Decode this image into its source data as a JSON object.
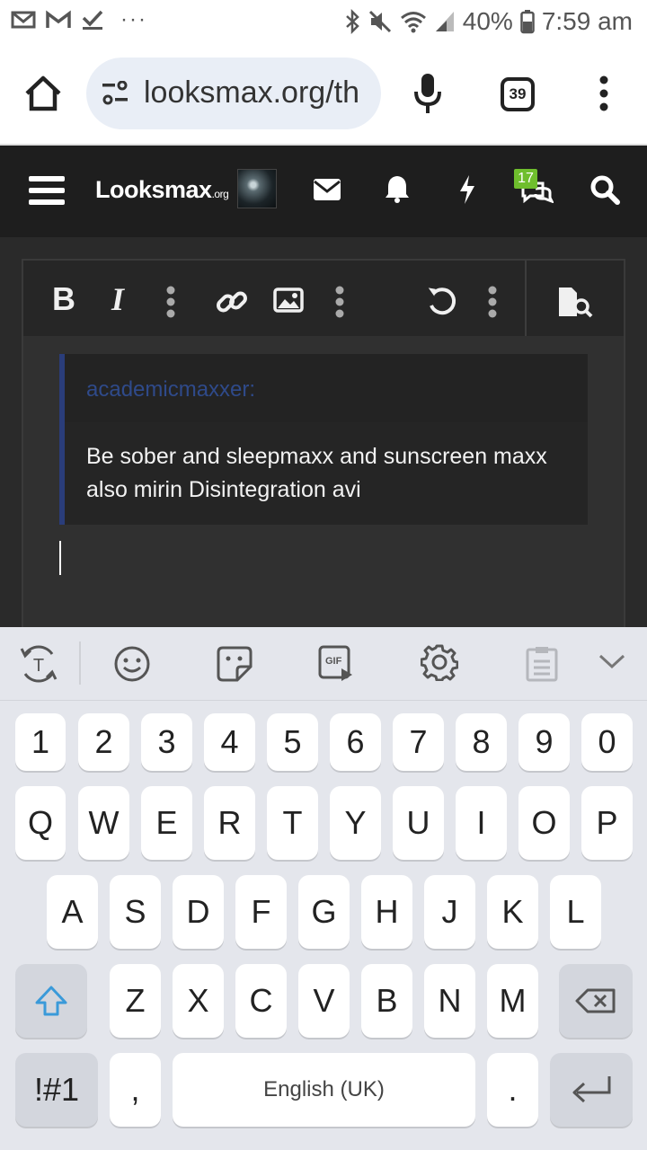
{
  "status_bar": {
    "battery": "40%",
    "time": "7:59 am",
    "overflow": "···"
  },
  "browser": {
    "url": "looksmax.org/th",
    "tab_count": "39"
  },
  "site": {
    "logo": "Looksmax",
    "logo_suffix": ".org",
    "conversations_badge": "17"
  },
  "editor": {
    "toolbar": {
      "bold": "B",
      "italic": "I"
    },
    "quote": {
      "author": "academicmaxxer:",
      "text": "Be sober and sleepmaxx and sunscreen maxx also mirin Disintegration avi"
    }
  },
  "keyboard": {
    "toolbar_gif": "GIF",
    "number_row": [
      "1",
      "2",
      "3",
      "4",
      "5",
      "6",
      "7",
      "8",
      "9",
      "0"
    ],
    "row1": [
      "Q",
      "W",
      "E",
      "R",
      "T",
      "Y",
      "U",
      "I",
      "O",
      "P"
    ],
    "row2": [
      "A",
      "S",
      "D",
      "F",
      "G",
      "H",
      "J",
      "K",
      "L"
    ],
    "row3": [
      "Z",
      "X",
      "C",
      "V",
      "B",
      "N",
      "M"
    ],
    "symbols_key": "!#1",
    "comma_key": ",",
    "space_label": "English (UK)",
    "period_key": "."
  }
}
